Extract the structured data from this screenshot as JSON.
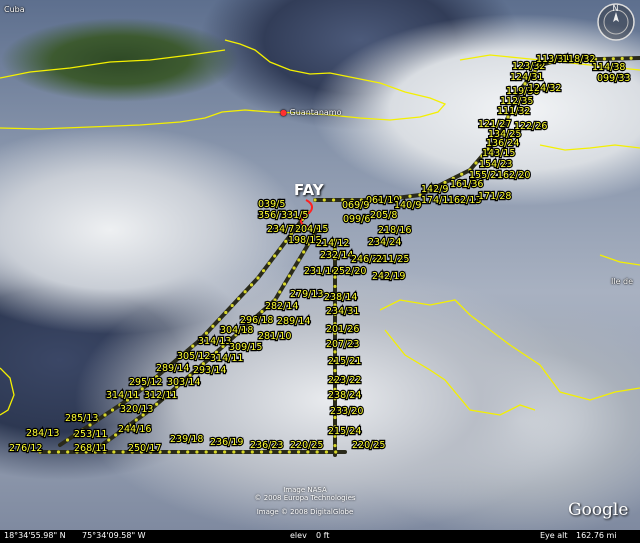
{
  "map": {
    "places": [
      {
        "name": "Cuba",
        "dot": false
      },
      {
        "name": "Guantanamo",
        "dot": true
      },
      {
        "name": "Ile de",
        "dot": false
      }
    ],
    "storm": {
      "name": "FAY"
    },
    "observations": [
      {
        "label": "039/5"
      },
      {
        "label": "356/7"
      },
      {
        "label": "331/5"
      },
      {
        "label": "234/7"
      },
      {
        "label": "204/15"
      },
      {
        "label": "198/15"
      },
      {
        "label": "214/12"
      },
      {
        "label": "232/14"
      },
      {
        "label": "246/22"
      },
      {
        "label": "211/25"
      },
      {
        "label": "231/16"
      },
      {
        "label": "252/20"
      },
      {
        "label": "242/19"
      },
      {
        "label": "279/13"
      },
      {
        "label": "238/14"
      },
      {
        "label": "282/14"
      },
      {
        "label": "234/31"
      },
      {
        "label": "296/18"
      },
      {
        "label": "289/14"
      },
      {
        "label": "201/26"
      },
      {
        "label": "304/18"
      },
      {
        "label": "281/10"
      },
      {
        "label": "207/23"
      },
      {
        "label": "314/13"
      },
      {
        "label": "309/15"
      },
      {
        "label": "305/12"
      },
      {
        "label": "314/11"
      },
      {
        "label": "215/21"
      },
      {
        "label": "289/14"
      },
      {
        "label": "293/14"
      },
      {
        "label": "223/22"
      },
      {
        "label": "295/12"
      },
      {
        "label": "303/14"
      },
      {
        "label": "238/24"
      },
      {
        "label": "314/11"
      },
      {
        "label": "312/11"
      },
      {
        "label": "320/13"
      },
      {
        "label": "233/20"
      },
      {
        "label": "285/13"
      },
      {
        "label": "215/24"
      },
      {
        "label": "284/13"
      },
      {
        "label": "253/11"
      },
      {
        "label": "244/16"
      },
      {
        "label": "239/18"
      },
      {
        "label": "236/19"
      },
      {
        "label": "236/23"
      },
      {
        "label": "220/25"
      },
      {
        "label": "220/25"
      },
      {
        "label": "276/12"
      },
      {
        "label": "268/11"
      },
      {
        "label": "250/17"
      },
      {
        "label": "061/10"
      },
      {
        "label": "069/9"
      },
      {
        "label": "140/9"
      },
      {
        "label": "099/6"
      },
      {
        "label": "205/8"
      },
      {
        "label": "218/16"
      },
      {
        "label": "234/24"
      },
      {
        "label": "142/9"
      },
      {
        "label": "174/11"
      },
      {
        "label": "162/13"
      },
      {
        "label": "171/28"
      },
      {
        "label": "161/36"
      },
      {
        "label": "155/21"
      },
      {
        "label": "162/20"
      },
      {
        "label": "154/23"
      },
      {
        "label": "143/15"
      },
      {
        "label": "136/24"
      },
      {
        "label": "134/25"
      },
      {
        "label": "122/26"
      },
      {
        "label": "121/27"
      },
      {
        "label": "111/32"
      },
      {
        "label": "112/35"
      },
      {
        "label": "119/36"
      },
      {
        "label": "124/32"
      },
      {
        "label": "124/31"
      },
      {
        "label": "123/32"
      },
      {
        "label": "113/34"
      },
      {
        "label": "118/32"
      },
      {
        "label": "114/38"
      },
      {
        "label": "099/33"
      }
    ],
    "credits": {
      "line1": "Image NASA",
      "line2": "© 2008 Europa Technologies",
      "line3": "Image © 2008 DigitalGlobe"
    },
    "logo": "Google",
    "compass_letter": "N"
  },
  "status_bar": {
    "lat": "18°34'55.98\" N",
    "lon": "75°34'09.58\" W",
    "elev_label": "elev",
    "elev_value": "0 ft",
    "eye_alt_label": "Eye alt",
    "eye_alt_value": "162.76 mi"
  }
}
